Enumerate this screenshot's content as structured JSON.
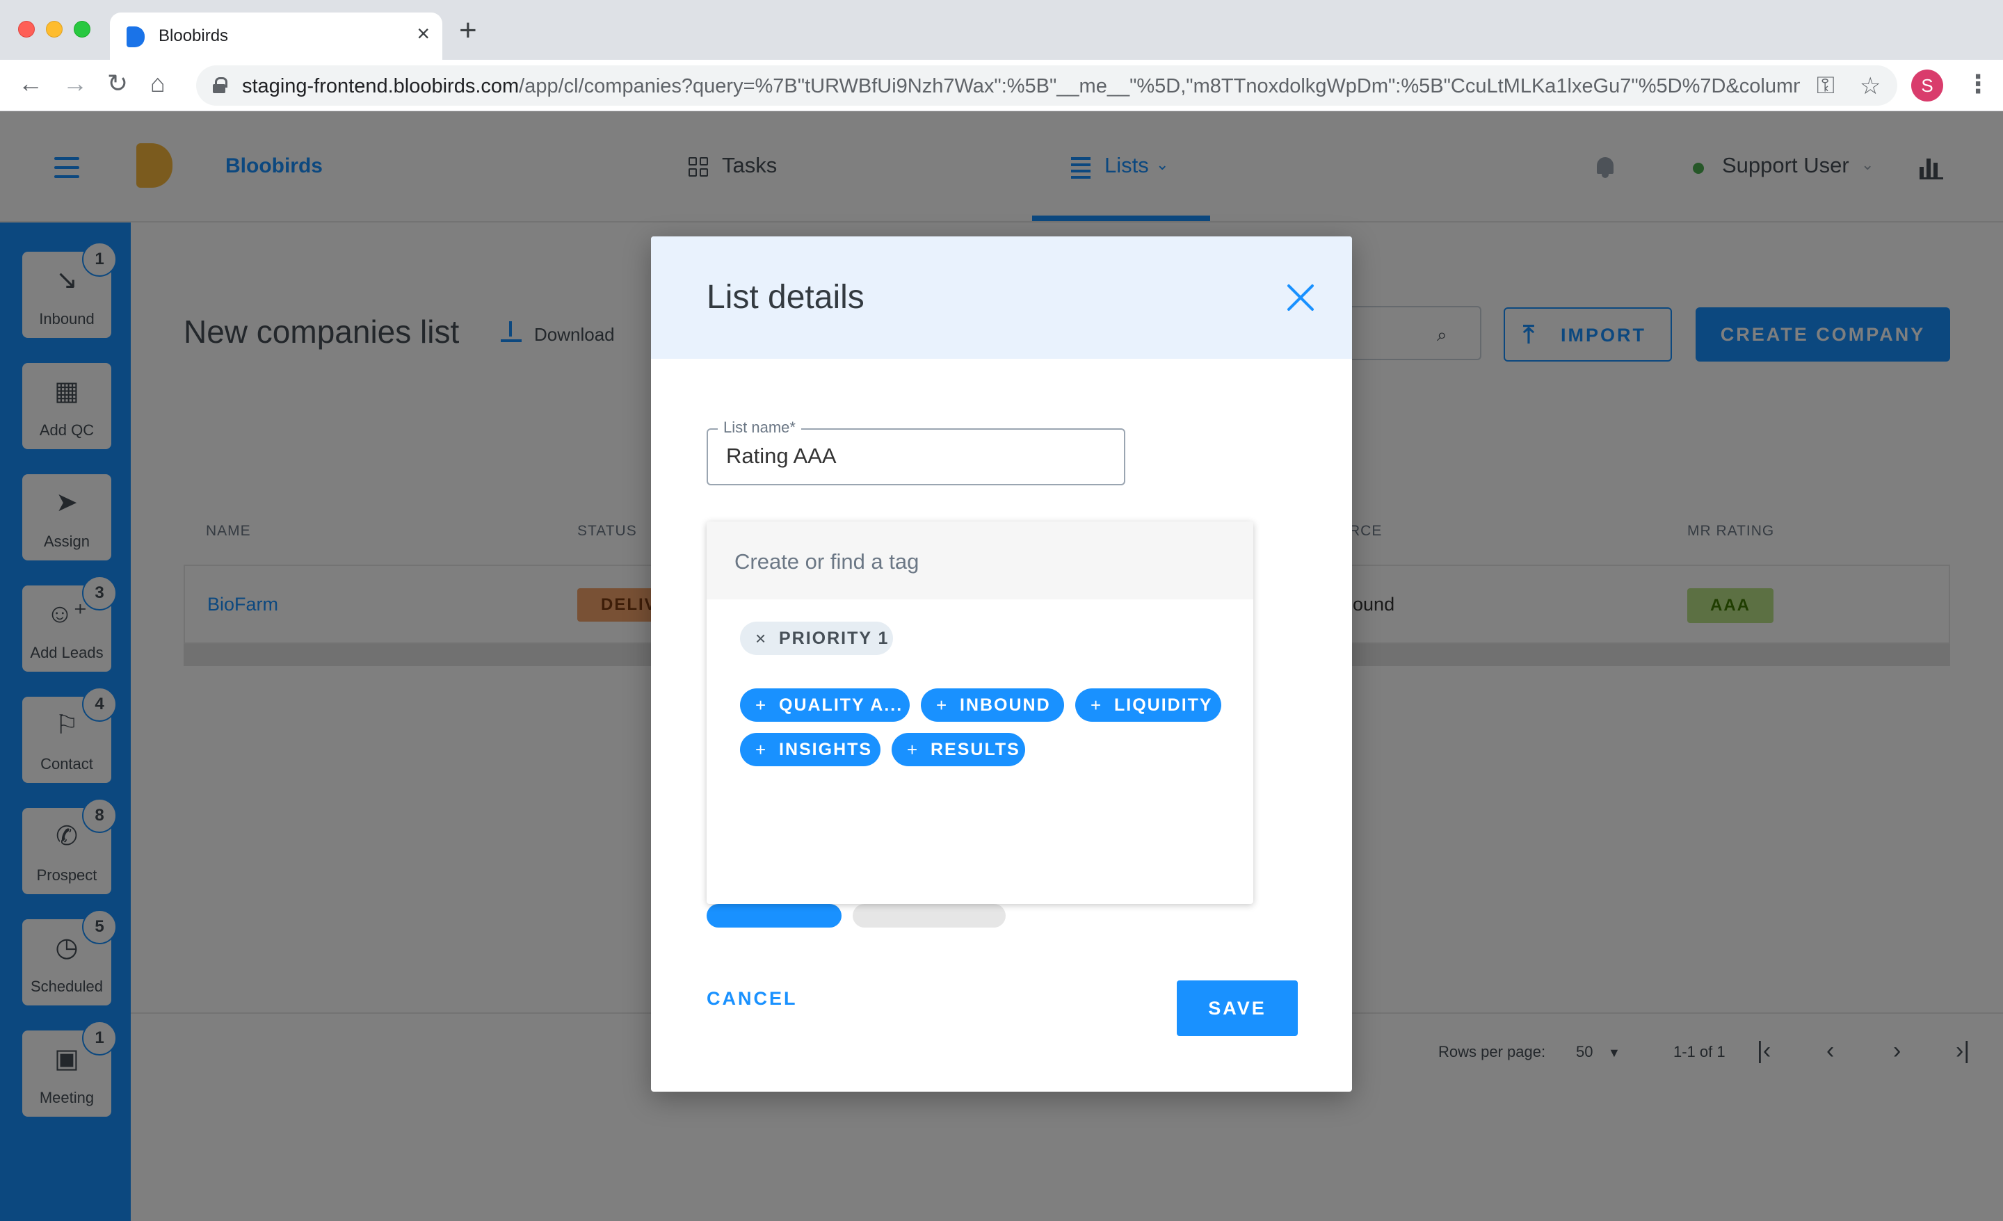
{
  "browser": {
    "tab_title": "Bloobirds",
    "url_host": "staging-frontend.bloobirds.com",
    "url_path": "/app/cl/companies?query=%7B\"tURWBfUi9Nzh7Wax\":%5B\"__me__\"%5D,\"m8TTnoxdolkgWpDm\":%5B\"CcuLtMLKa1lxeGu7\"%5D%7D&columns=j...",
    "profile_initial": "S"
  },
  "header": {
    "brand": "Bloobirds",
    "nav_tasks": "Tasks",
    "nav_lists": "Lists",
    "user_name": "Support User",
    "colors": {
      "accent": "#1991ff",
      "logo": "#f6b73c"
    }
  },
  "sidebar": {
    "items": [
      {
        "label": "Inbound",
        "badge": "1"
      },
      {
        "label": "Add QC",
        "badge": ""
      },
      {
        "label": "Assign",
        "badge": ""
      },
      {
        "label": "Add Leads",
        "badge": "3"
      },
      {
        "label": "Contact",
        "badge": "4"
      },
      {
        "label": "Prospect",
        "badge": "8"
      },
      {
        "label": "Scheduled",
        "badge": "5"
      },
      {
        "label": "Meeting",
        "badge": "1"
      }
    ]
  },
  "main": {
    "title": "New companies list",
    "download_label": "Download",
    "import_label": "IMPORT",
    "create_label": "CREATE COMPANY",
    "columns": [
      "NAME",
      "STATUS",
      "RCE",
      "MR RATING"
    ],
    "rows": [
      {
        "name": "BioFarm",
        "status": "DELIV",
        "source": "bound",
        "rating": "AAA"
      }
    ],
    "pagination": {
      "rows_per_page_label": "Rows per page:",
      "rows_per_page": "50",
      "range": "1-1 of 1"
    }
  },
  "modal": {
    "title": "List details",
    "list_name_label": "List name*",
    "list_name_value": "Rating AAA",
    "tag_placeholder": "Create or find a tag",
    "selected_tags": [
      "PRIORITY 1"
    ],
    "available_tags": [
      "QUALITY A...",
      "INBOUND",
      "LIQUIDITY",
      "INSIGHTS",
      "RESULTS"
    ],
    "cancel_label": "CANCEL",
    "save_label": "SAVE"
  }
}
